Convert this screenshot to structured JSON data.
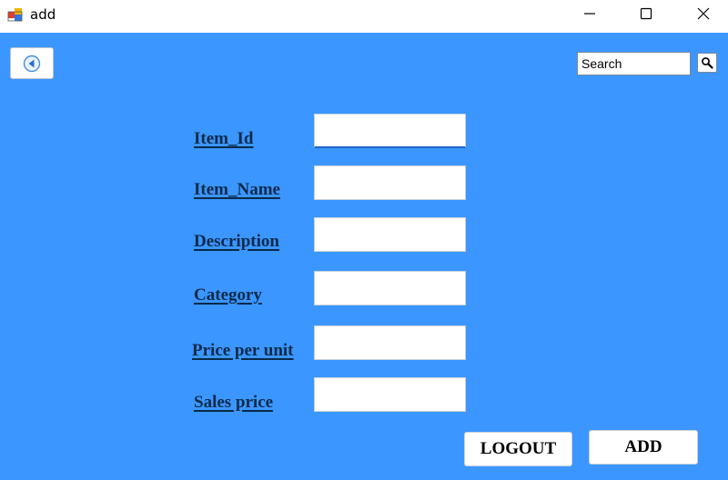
{
  "window": {
    "title": "add"
  },
  "search": {
    "value": "Search"
  },
  "form": {
    "fields": [
      {
        "label": "Item_Id",
        "value": ""
      },
      {
        "label": "Item_Name",
        "value": ""
      },
      {
        "label": "Description",
        "value": ""
      },
      {
        "label": "Category",
        "value": ""
      },
      {
        "label": "Price per unit",
        "value": ""
      },
      {
        "label": "Sales price",
        "value": ""
      }
    ]
  },
  "buttons": {
    "logout": "LOGOUT",
    "add": "ADD"
  },
  "colors": {
    "background": "#3b96ff",
    "label_text": "#0a2a4a",
    "focus_underline": "#1a64c8"
  },
  "icons": {
    "app": "app-icon",
    "back": "back-arrow-icon",
    "search": "magnifier-icon"
  }
}
